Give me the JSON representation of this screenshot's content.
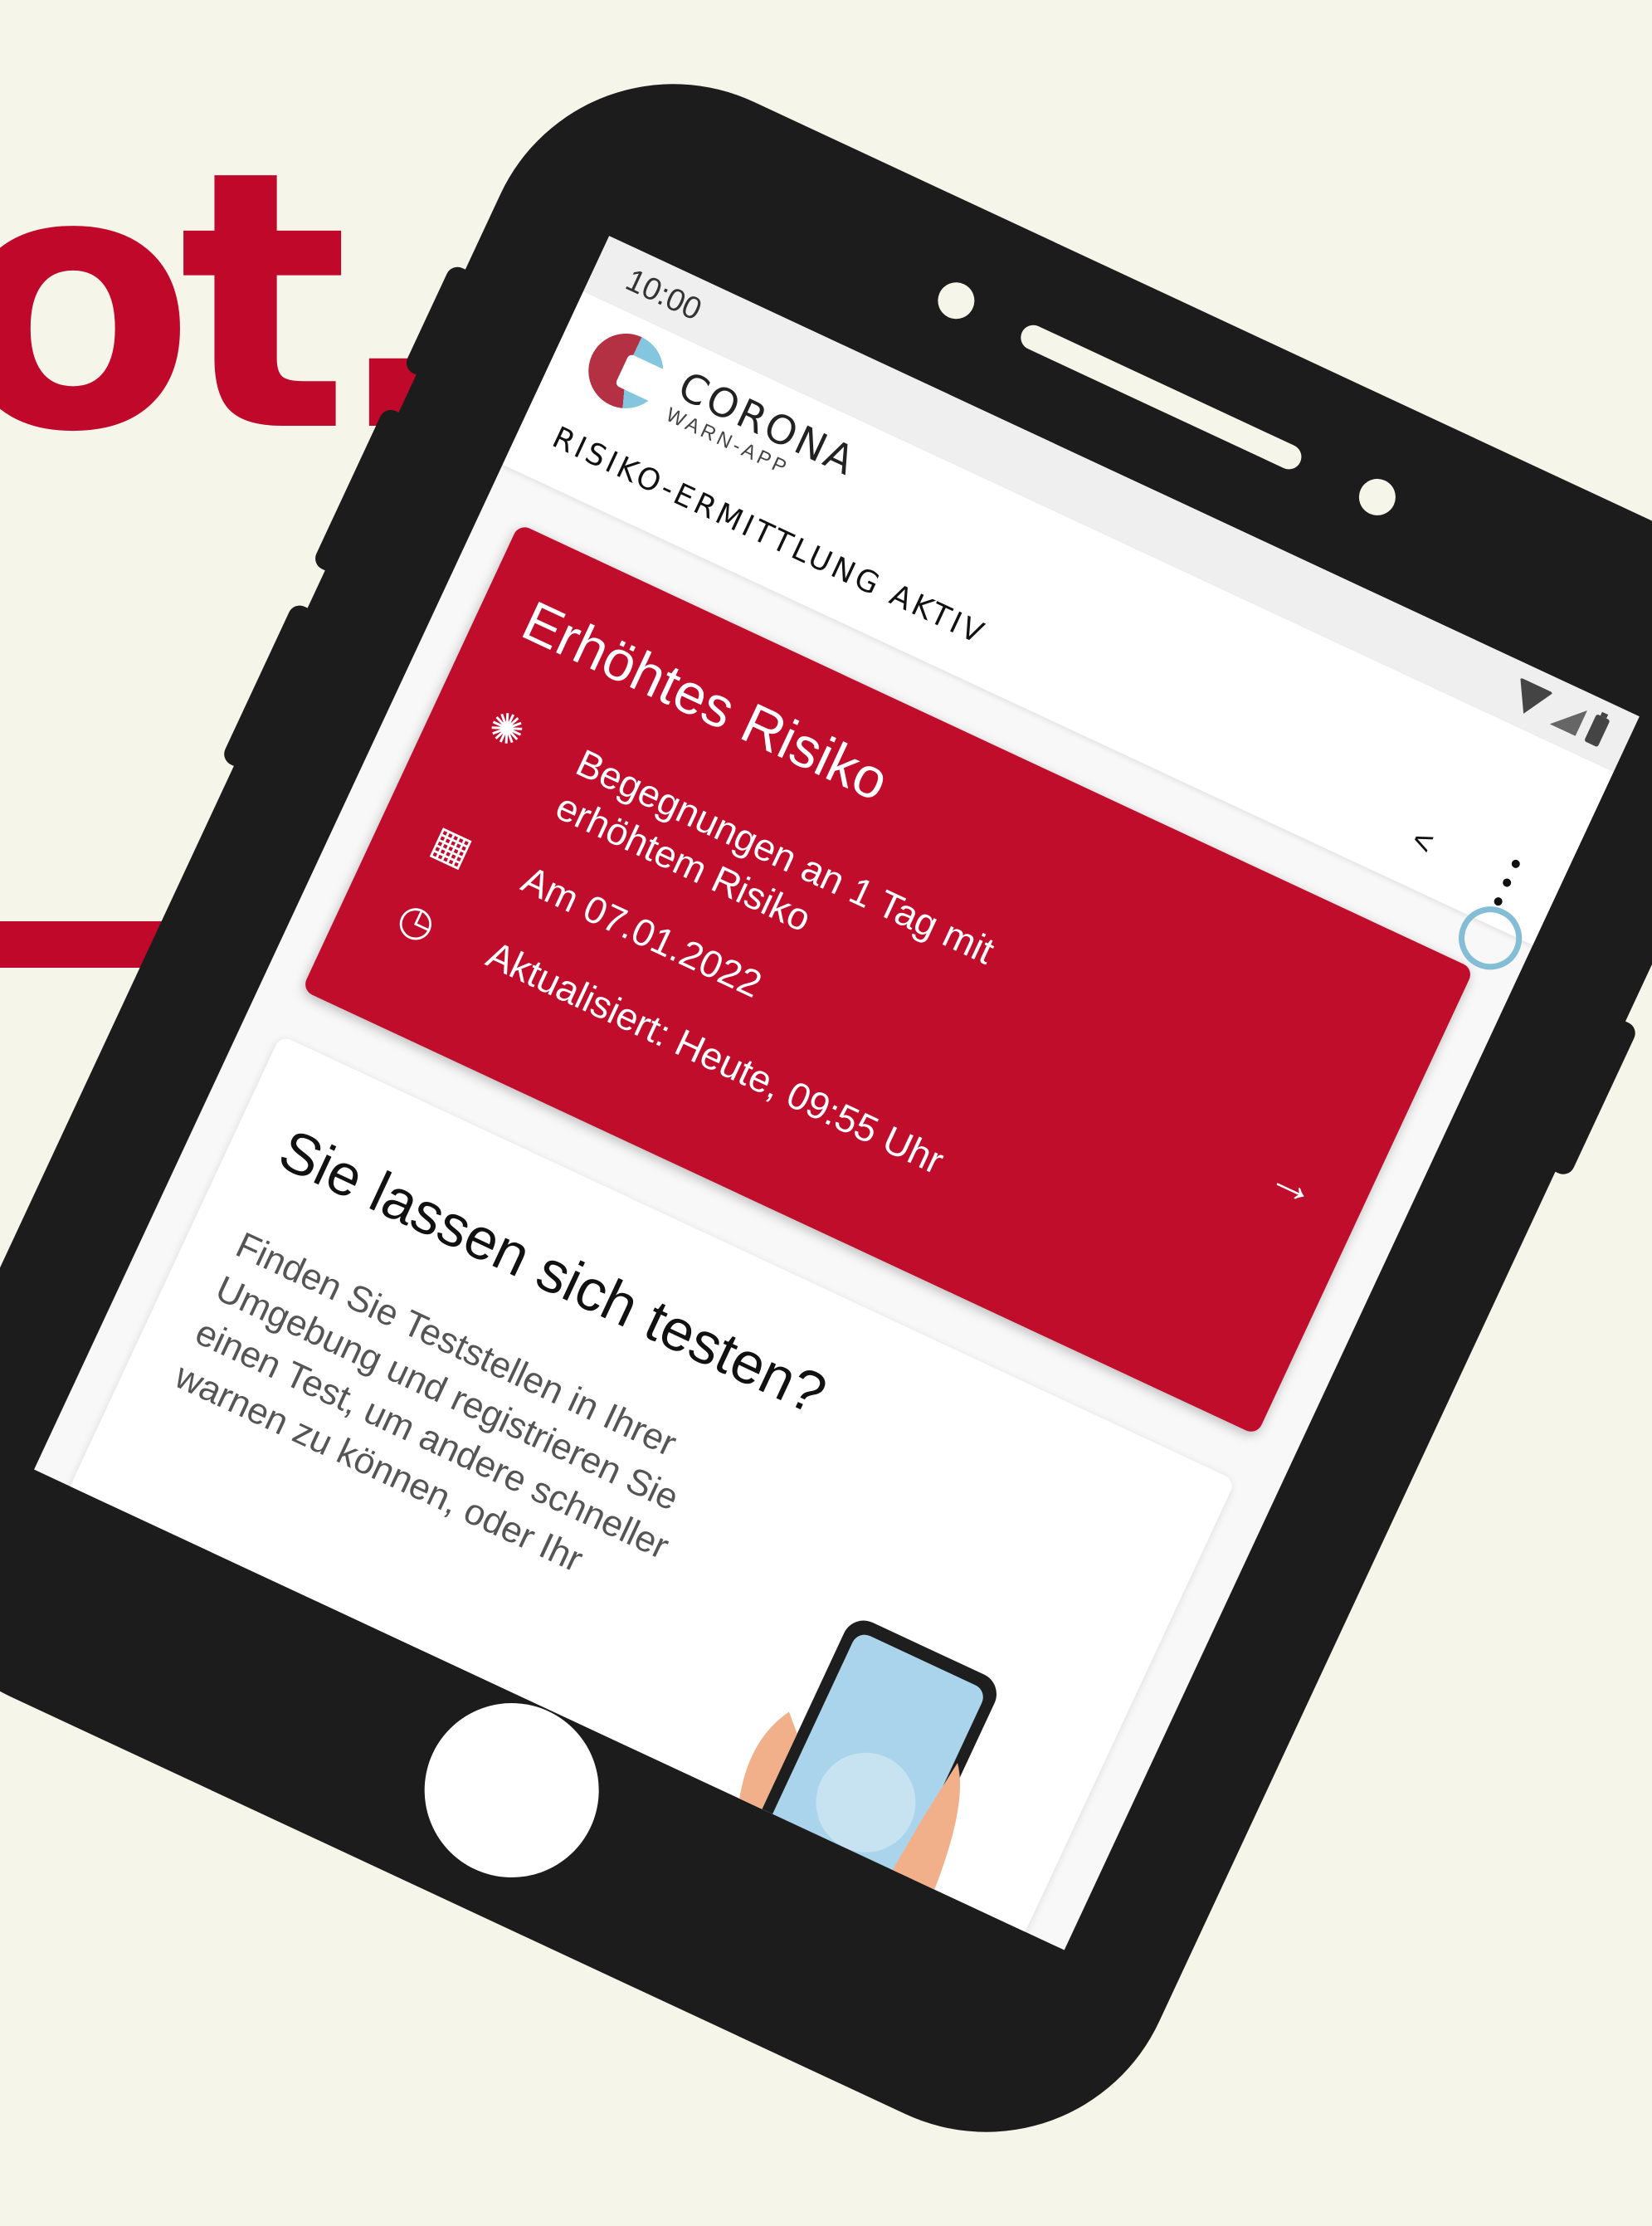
{
  "headline": "ot.",
  "status_bar": {
    "time": "10:00"
  },
  "app": {
    "logo_title": "CORONA",
    "logo_subtitle": "WARN-APP",
    "status_text": "RISIKO-ERMITTLUNG AKTIV"
  },
  "risk_card": {
    "title": "Erhöhtes Risiko",
    "encounters": "Begegnungen an 1 Tag mit erhöhtem Risiko",
    "date": "Am 07.01.2022",
    "updated": "Aktualisiert: Heute, 09:55 Uhr",
    "color": "#c00d2c"
  },
  "test_card": {
    "title": "Sie lassen sich testen?",
    "text": "Finden Sie Teststellen in Ihrer Umgebung und registrieren Sie einen Test, um andere schneller warnen zu können, oder Ihr"
  },
  "icons": [
    "share-icon",
    "more-vert-icon",
    "virus-icon",
    "calendar-icon",
    "clock-refresh-icon",
    "arrow-right-icon"
  ],
  "colors": {
    "background": "#f5f5ea",
    "accent": "#c0082b",
    "phone": "#1c1c1c"
  }
}
